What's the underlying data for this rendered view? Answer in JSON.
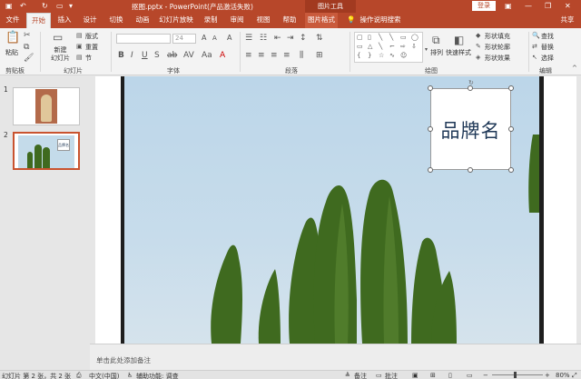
{
  "titlebar": {
    "title": "抠图.pptx - PowerPoint(产品激活失败)",
    "context_tool": "图片工具",
    "login": "登录"
  },
  "tabs": [
    "文件",
    "开始",
    "插入",
    "设计",
    "切换",
    "动画",
    "幻灯片放映",
    "录制",
    "审阅",
    "视图",
    "帮助",
    "图片格式",
    "操作说明搜索"
  ],
  "tellme_icon": "lightbulb-icon",
  "share": "共享",
  "ribbon": {
    "paste": "粘贴",
    "new_slide": "新建\n幻灯片",
    "layout": "版式",
    "reset": "重置",
    "section": "节",
    "arrange": "排列",
    "quick_styles": "快速样式",
    "shape_fill": "形状填充",
    "shape_outline": "形状轮廓",
    "shape_effects": "形状效果",
    "find": "查找",
    "replace": "替换",
    "select": "选择",
    "font_size": "24",
    "groups": {
      "clipboard": "剪贴板",
      "slides": "幻灯片",
      "font": "字体",
      "paragraph": "段落",
      "drawing": "绘图",
      "editing": "编辑"
    }
  },
  "slides": [
    {
      "number": "1"
    },
    {
      "number": "2"
    }
  ],
  "slide": {
    "brand_text": "品牌名",
    "thumb_brand_text": "品牌名"
  },
  "notes_placeholder": "单击此处添加备注",
  "status": {
    "slide_info": "幻灯片 第 2 张，共 2 张",
    "language": "中文(中国)",
    "accessibility": "辅助功能: 调查",
    "notes_btn": "备注",
    "comments_btn": "批注",
    "zoom": "80%"
  },
  "colors": {
    "accent": "#b7472a",
    "brand_text": "#1f3857",
    "tree_green": "#3f6a1f"
  }
}
